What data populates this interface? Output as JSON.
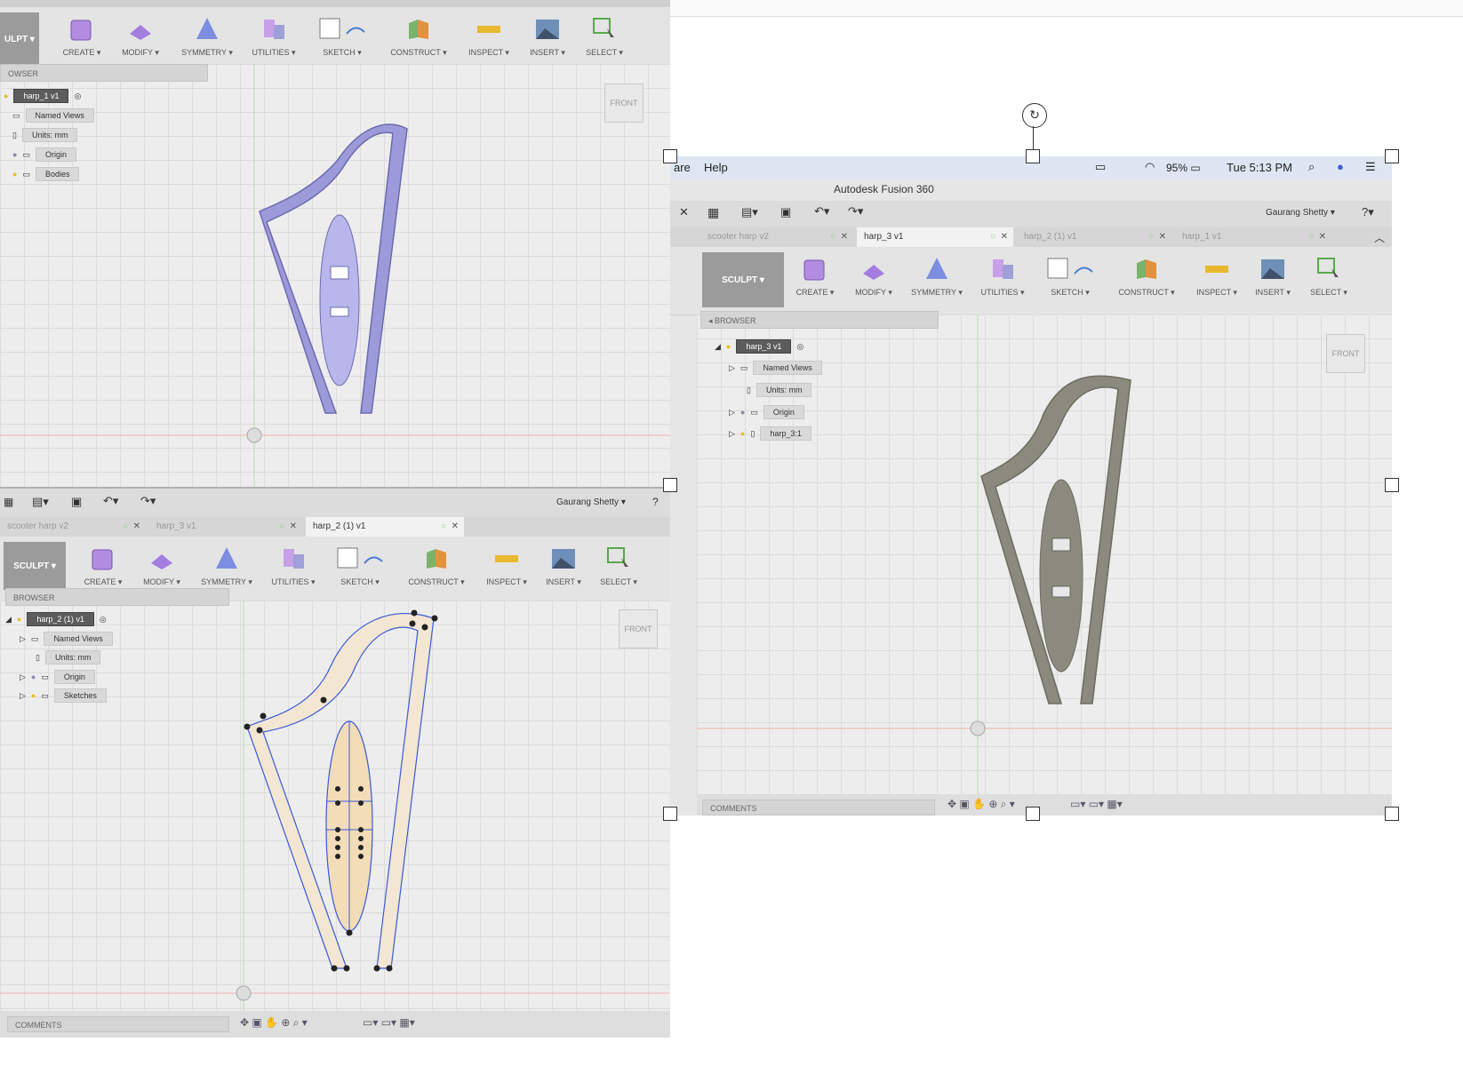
{
  "tl": {
    "sculpt": "ULPT ▾",
    "toolbar": [
      "CREATE ▾",
      "MODIFY ▾",
      "SYMMETRY ▾",
      "UTILITIES ▾",
      "SKETCH ▾",
      "CONSTRUCT ▾",
      "INSPECT ▾",
      "INSERT ▾",
      "SELECT ▾"
    ],
    "browser_label": "OWSER",
    "tree": [
      "harp_1 v1",
      "Named Views",
      "Units: mm",
      "Origin",
      "Bodies"
    ],
    "viewcube": "FRONT"
  },
  "bl": {
    "user": "Gaurang Shetty ▾",
    "tabs": [
      "scooter harp v2",
      "harp_3 v1",
      "harp_2 (1) v1"
    ],
    "sculpt": "SCULPT ▾",
    "toolbar": [
      "CREATE ▾",
      "MODIFY ▾",
      "SYMMETRY ▾",
      "UTILITIES ▾",
      "SKETCH ▾",
      "CONSTRUCT ▾",
      "INSPECT ▾",
      "INSERT ▾",
      "SELECT ▾"
    ],
    "browser_label": "BROWSER",
    "tree": [
      "harp_2 (1) v1",
      "Named Views",
      "Units: mm",
      "Origin",
      "Sketches"
    ],
    "viewcube": "FRONT",
    "comments": "COMMENTS"
  },
  "r": {
    "menu": {
      "left": "are",
      "help": "Help",
      "battery": "95%",
      "time": "Tue 5:13 PM"
    },
    "app_title": "Autodesk Fusion 360",
    "user": "Gaurang Shetty ▾",
    "tabs": [
      "scooter harp v2",
      "harp_3 v1",
      "harp_2 (1) v1",
      "harp_1 v1"
    ],
    "sculpt": "SCULPT ▾",
    "toolbar": [
      "CREATE ▾",
      "MODIFY ▾",
      "SYMMETRY ▾",
      "UTILITIES ▾",
      "SKETCH ▾",
      "CONSTRUCT ▾",
      "INSPECT ▾",
      "INSERT ▾",
      "SELECT ▾"
    ],
    "browser_label": "BROWSER",
    "tree": [
      "harp_3 v1",
      "Named Views",
      "Units: mm",
      "Origin",
      "harp_3:1"
    ],
    "viewcube": "FRONT",
    "comments": "COMMENTS"
  },
  "colors": {
    "mesh": "#9c9ad8",
    "sketch_fill": "#f3dcb8",
    "body": "#8a8a7e",
    "accent_green": "#7ac36a"
  }
}
